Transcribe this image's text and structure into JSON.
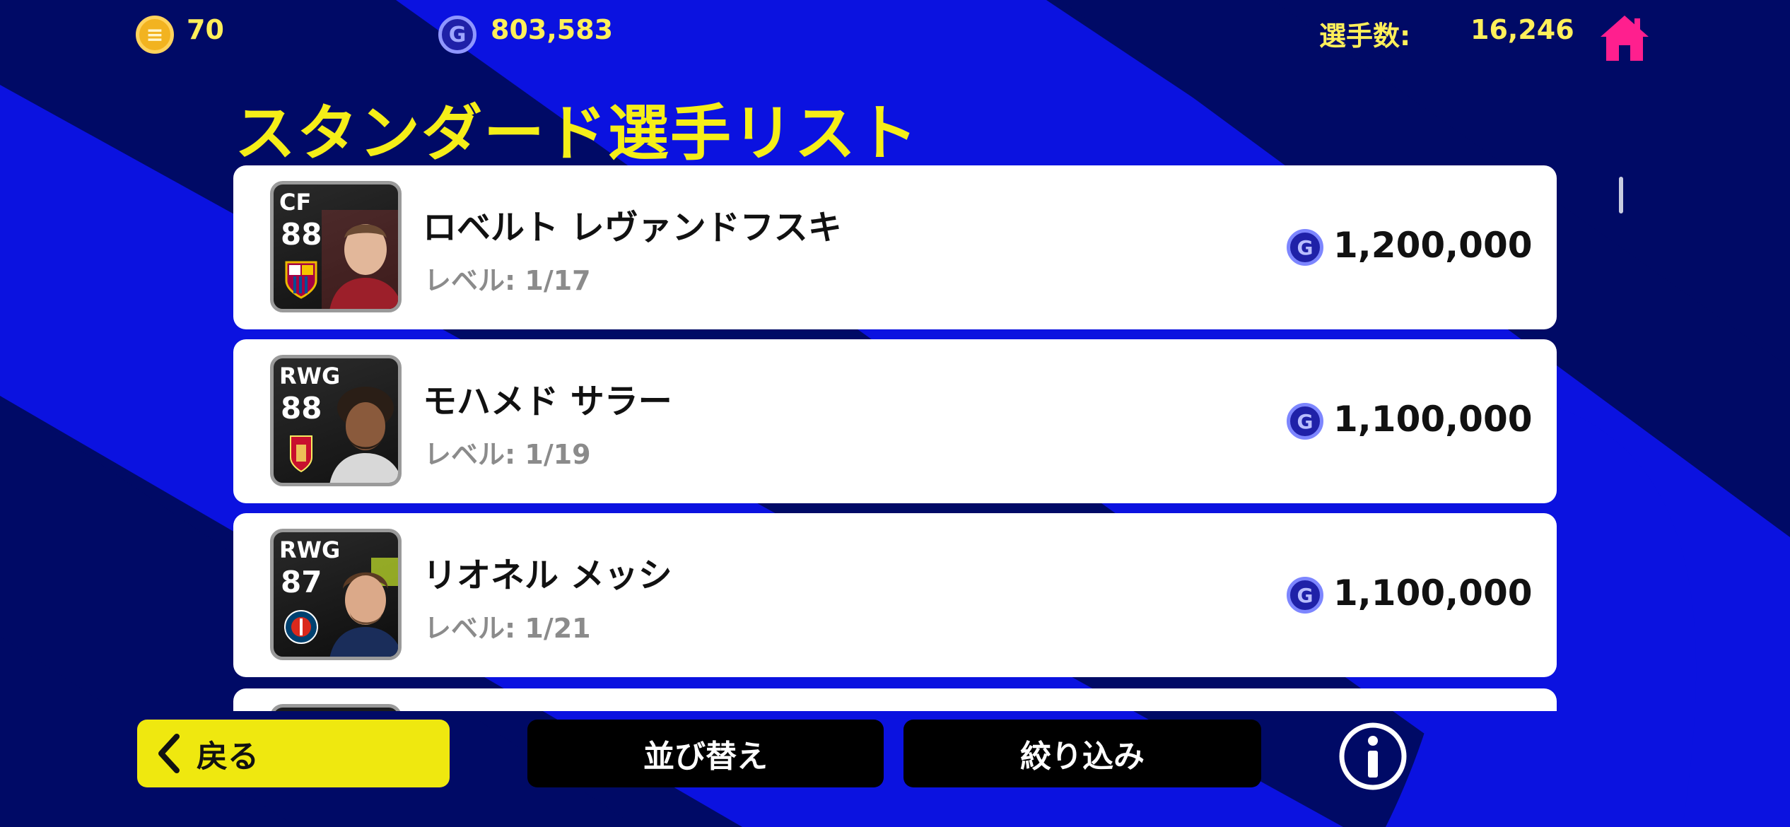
{
  "header": {
    "coins": "70",
    "gp": "803,583",
    "players_label": "選手数:",
    "players_count": "16,246"
  },
  "title": "スタンダード選手リスト",
  "players": [
    {
      "position": "CF",
      "rating": "88",
      "name": "ロベルト レヴァンドフスキ",
      "level": "レベル: 1/17",
      "price": "1,200,000"
    },
    {
      "position": "RWG",
      "rating": "88",
      "name": "モハメド サラー",
      "level": "レベル: 1/19",
      "price": "1,100,000"
    },
    {
      "position": "RWG",
      "rating": "87",
      "name": "リオネル メッシ",
      "level": "レベル: 1/21",
      "price": "1,100,000"
    }
  ],
  "footer": {
    "back_label": "戻る",
    "sort_label": "並び替え",
    "filter_label": "絞り込み"
  },
  "colors": {
    "accent_yellow": "#f5ee18",
    "home_pink": "#ff1f8e",
    "bg_dark_blue": "#000a66",
    "bg_bright_blue": "#0b12e0"
  }
}
